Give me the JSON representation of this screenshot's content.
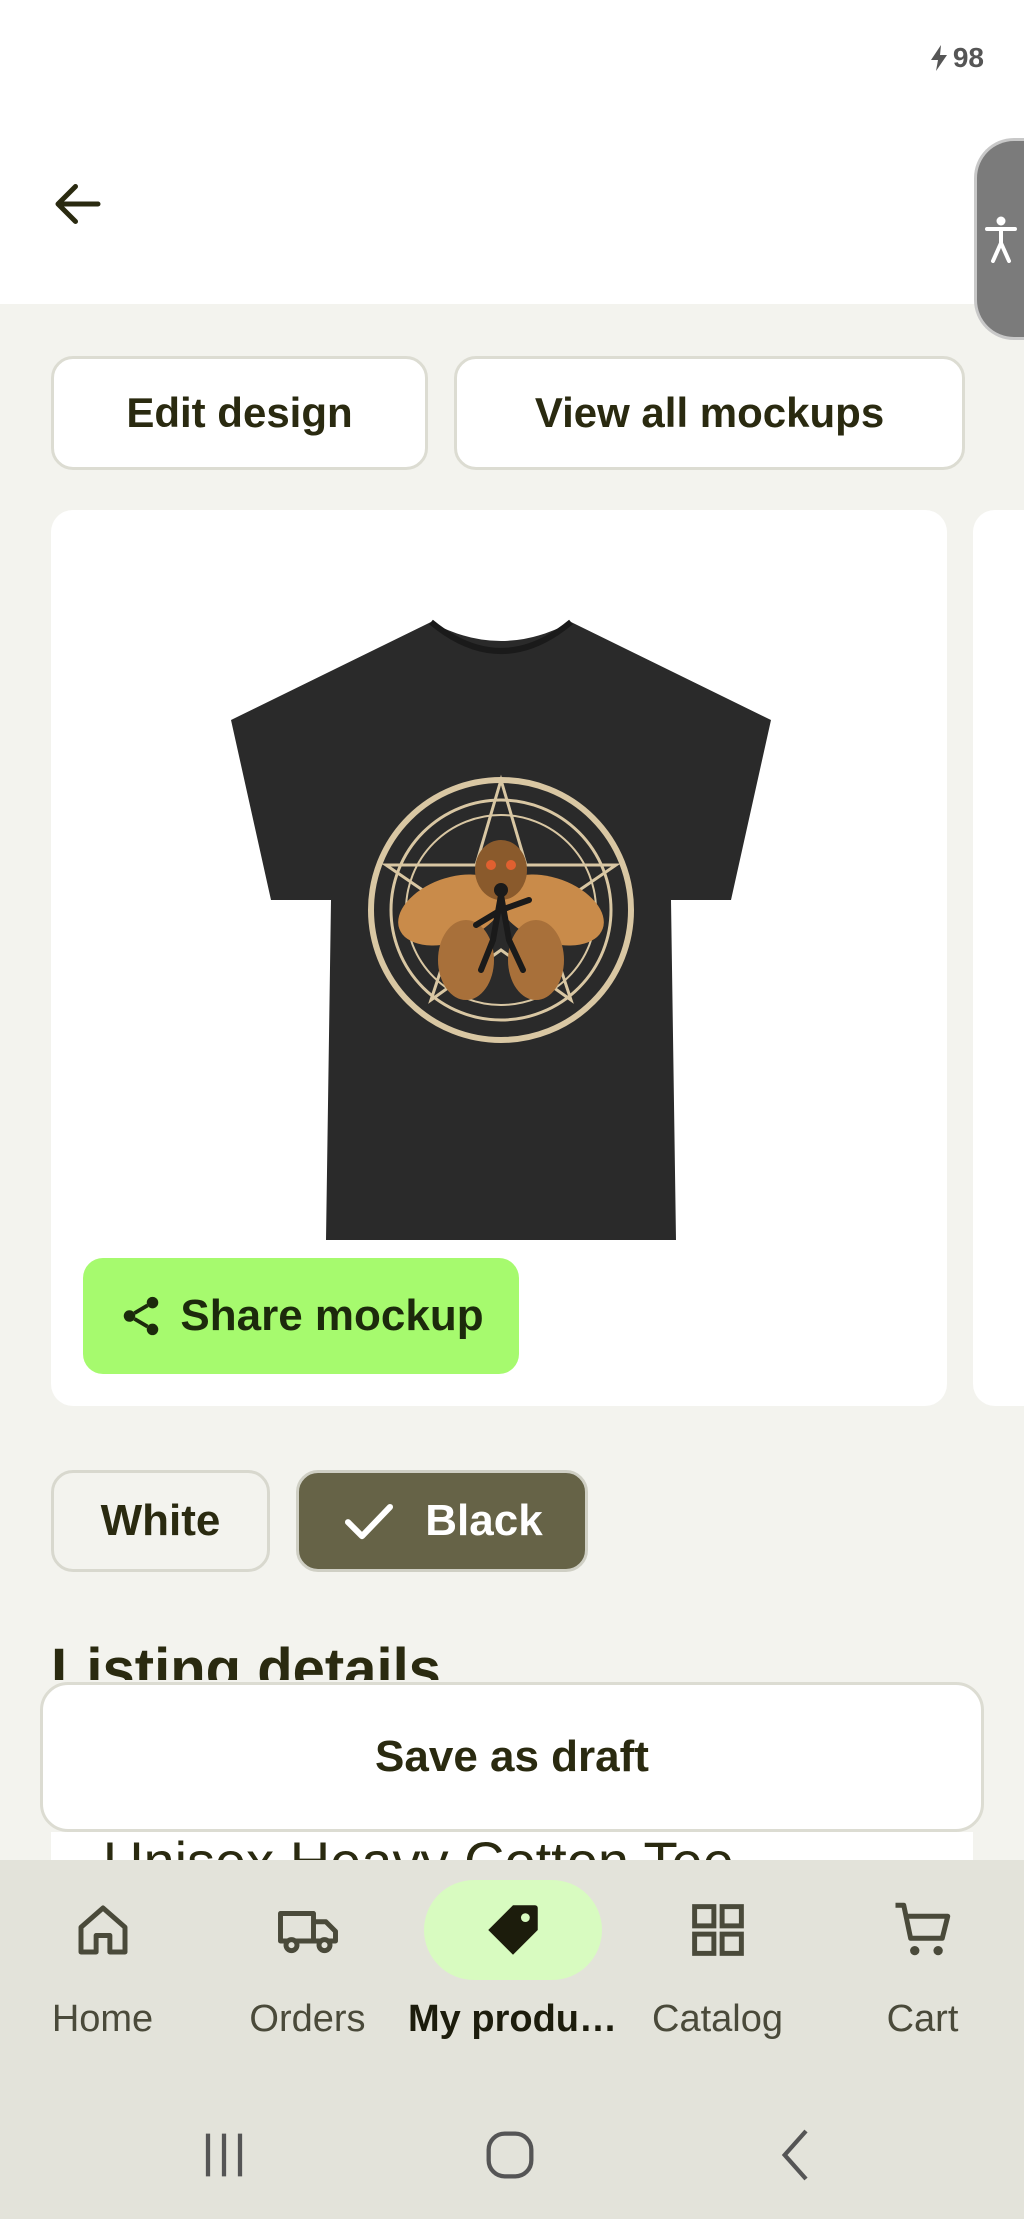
{
  "status": {
    "battery": "98"
  },
  "actions": {
    "edit_design": "Edit design",
    "view_all_mockups": "View all mockups"
  },
  "mockup": {
    "share_label": "Share mockup",
    "shirt_color": "#2a2a2a",
    "design_colors": [
      "#d9c7a3",
      "#c98b4a"
    ]
  },
  "colors": {
    "options": [
      {
        "label": "White",
        "selected": false
      },
      {
        "label": "Black",
        "selected": true
      }
    ]
  },
  "listing": {
    "section_title": "Listing details",
    "product_title_peek": "Unisex Heavy Cotton Tee"
  },
  "footer": {
    "save_draft": "Save as draft"
  },
  "nav": {
    "items": [
      {
        "label": "Home",
        "icon": "home-icon",
        "active": false
      },
      {
        "label": "Orders",
        "icon": "truck-icon",
        "active": false
      },
      {
        "label": "My produ…",
        "icon": "tag-icon",
        "active": true
      },
      {
        "label": "Catalog",
        "icon": "grid-icon",
        "active": false
      },
      {
        "label": "Cart",
        "icon": "cart-icon",
        "active": false
      }
    ]
  },
  "theme": {
    "accent": "#a6fa6e",
    "selected_chip": "#666347",
    "nav_active": "#d8fbc0"
  }
}
